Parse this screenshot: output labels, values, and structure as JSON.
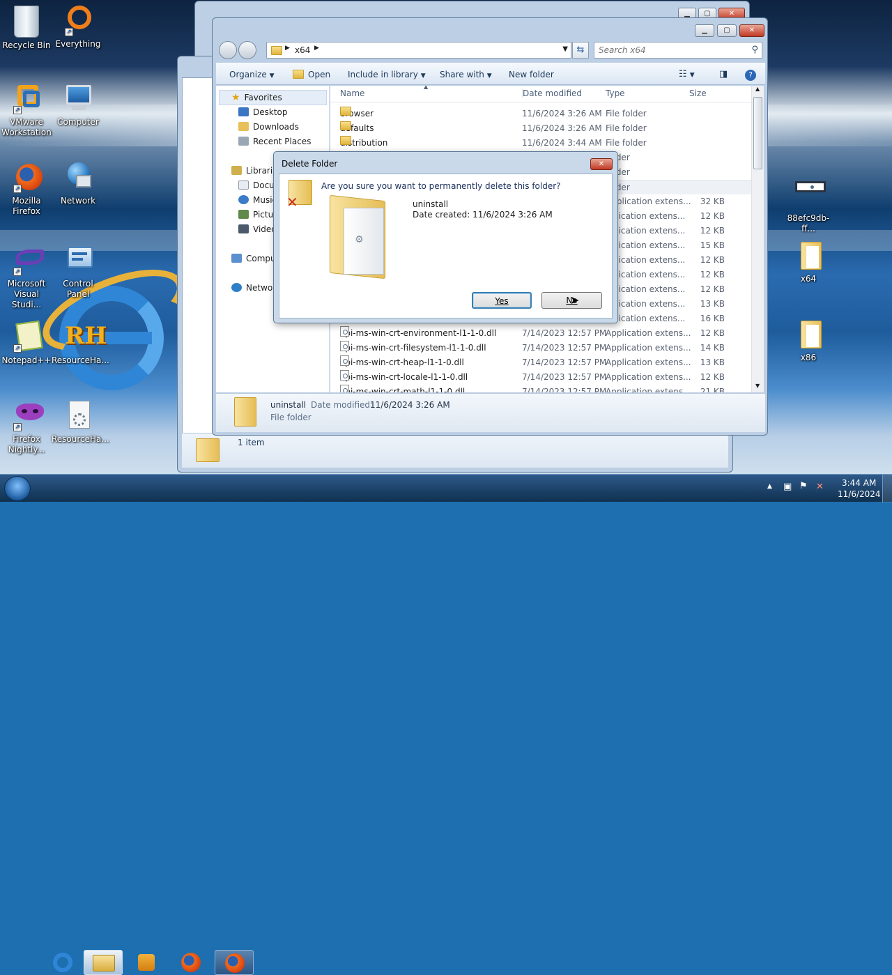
{
  "desktop": {
    "icons": [
      {
        "id": "recycle",
        "label": "Recycle Bin",
        "icon": "recycle-bin-icon"
      },
      {
        "id": "everything",
        "label": "Everything",
        "icon": "everything-icon"
      },
      {
        "id": "vmware",
        "label": "VMware Workstation",
        "icon": "vmware-icon"
      },
      {
        "id": "computer",
        "label": "Computer",
        "icon": "computer-icon"
      },
      {
        "id": "firefox",
        "label": "Mozilla Firefox",
        "icon": "firefox-icon"
      },
      {
        "id": "network",
        "label": "Network",
        "icon": "network-icon"
      },
      {
        "id": "vs",
        "label": "Microsoft Visual Studi...",
        "icon": "visual-studio-icon"
      },
      {
        "id": "control",
        "label": "Control Panel",
        "icon": "control-panel-icon"
      },
      {
        "id": "notepad",
        "label": "Notepad++",
        "icon": "notepad-plus-plus-icon"
      },
      {
        "id": "resourcehacker",
        "label": "ResourceHa...",
        "icon": "resource-hacker-icon"
      },
      {
        "id": "nightly",
        "label": "Firefox Nightly...",
        "icon": "firefox-nightly-icon"
      },
      {
        "id": "resourcehacker2",
        "label": "ResourceHa...",
        "icon": "resource-hacker-setup-icon"
      },
      {
        "id": "hashfile",
        "label": "88efc9db-ff...",
        "icon": "file-icon"
      },
      {
        "id": "x64",
        "label": "x64",
        "icon": "folder-icon"
      },
      {
        "id": "x86",
        "label": "x86",
        "icon": "folder-icon"
      }
    ]
  },
  "bg_window": {
    "status": "1 item"
  },
  "explorer": {
    "path": "x64",
    "search_placeholder": "Search x64",
    "toolbar": {
      "organize": "Organize",
      "open": "Open",
      "include": "Include in library",
      "share": "Share with",
      "new_folder": "New folder"
    },
    "nav": {
      "favorites": "Favorites",
      "desktop": "Desktop",
      "downloads": "Downloads",
      "recent": "Recent Places",
      "libraries": "Librarie",
      "documents": "Docu",
      "music": "Music",
      "pictures": "Pictur",
      "videos": "Video",
      "computer": "Compu",
      "network": "Networ"
    },
    "columns": {
      "name": "Name",
      "date": "Date modified",
      "type": "Type",
      "size": "Size"
    },
    "rows": [
      {
        "name": "browser",
        "date": "11/6/2024 3:26 AM",
        "type": "File folder",
        "size": ""
      },
      {
        "name": "defaults",
        "date": "11/6/2024 3:26 AM",
        "type": "File folder",
        "size": ""
      },
      {
        "name": "distribution",
        "date": "11/6/2024 3:44 AM",
        "type": "File folder",
        "size": ""
      },
      {
        "name": "",
        "date": "",
        "type": "folder",
        "size": ""
      },
      {
        "name": "",
        "date": "",
        "type": "folder",
        "size": ""
      },
      {
        "name": "",
        "date": "",
        "type": "folder",
        "size": ""
      },
      {
        "name": "",
        "date": "",
        "type": "Application extens...",
        "size": "32 KB"
      },
      {
        "name": "",
        "date": "",
        "type": "pplication extens...",
        "size": "12 KB"
      },
      {
        "name": "",
        "date": "",
        "type": "pplication extens...",
        "size": "12 KB"
      },
      {
        "name": "",
        "date": "",
        "type": "pplication extens...",
        "size": "15 KB"
      },
      {
        "name": "",
        "date": "",
        "type": "pplication extens...",
        "size": "12 KB"
      },
      {
        "name": "",
        "date": "",
        "type": "pplication extens...",
        "size": "12 KB"
      },
      {
        "name": "",
        "date": "",
        "type": "pplication extens...",
        "size": "12 KB"
      },
      {
        "name": "",
        "date": "",
        "type": "pplication extens...",
        "size": "13 KB"
      },
      {
        "name": "",
        "date": "",
        "type": "pplication extens...",
        "size": "16 KB"
      },
      {
        "name": "api-ms-win-crt-environment-l1-1-0.dll",
        "date": "7/14/2023 12:57 PM",
        "type": "Application extens...",
        "size": "12 KB"
      },
      {
        "name": "api-ms-win-crt-filesystem-l1-1-0.dll",
        "date": "7/14/2023 12:57 PM",
        "type": "Application extens...",
        "size": "14 KB"
      },
      {
        "name": "api-ms-win-crt-heap-l1-1-0.dll",
        "date": "7/14/2023 12:57 PM",
        "type": "Application extens...",
        "size": "13 KB"
      },
      {
        "name": "api-ms-win-crt-locale-l1-1-0.dll",
        "date": "7/14/2023 12:57 PM",
        "type": "Application extens...",
        "size": "12 KB"
      },
      {
        "name": "api-ms-win-crt-math-l1-1-0.dll",
        "date": "7/14/2023 12:57 PM",
        "type": "Application extens...",
        "size": "21 KB"
      }
    ],
    "details": {
      "name": "uninstall",
      "date_label": "Date modified:",
      "date": "11/6/2024 3:26 AM",
      "type": "File folder"
    }
  },
  "dialog": {
    "title": "Delete Folder",
    "question": "Are you sure you want to permanently delete this folder?",
    "item_name": "uninstall",
    "item_date": "Date created: 11/6/2024 3:26 AM",
    "yes": "Yes",
    "no": "No"
  },
  "taskbar": {
    "time": "3:44 AM",
    "date": "11/6/2024"
  },
  "colors": {
    "selection": "#cce8ff",
    "window_frame": "#bccfe4",
    "close_red": "#c13a25",
    "taskbar": "#17395f"
  }
}
